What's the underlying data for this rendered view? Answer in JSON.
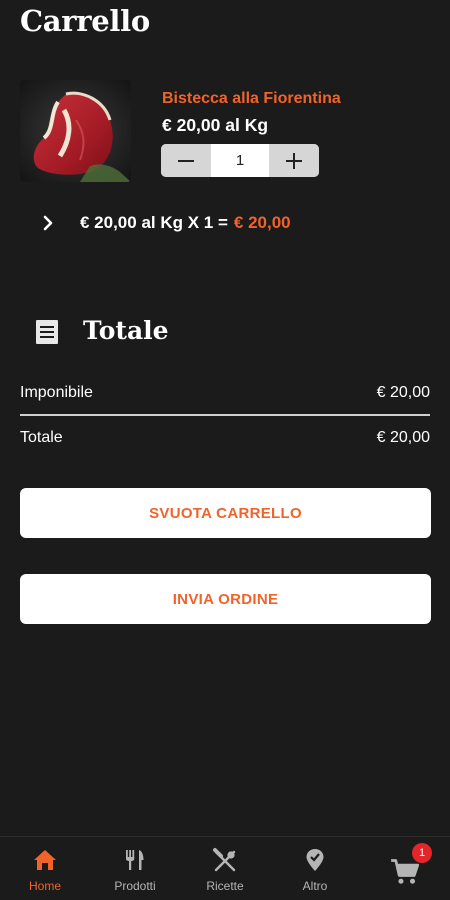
{
  "header": {
    "title": "Carrello"
  },
  "cart_items": [
    {
      "name": "Bistecca alla Fiorentina",
      "unit_price": "€ 20,00 al Kg",
      "quantity": "1",
      "line_calc": "€ 20,00 al Kg X 1 =",
      "line_total": "€ 20,00"
    }
  ],
  "summary": {
    "title": "Totale",
    "rows": [
      {
        "label": "Imponibile",
        "value": "€ 20,00"
      },
      {
        "label": "Totale",
        "value": "€ 20,00"
      }
    ]
  },
  "actions": {
    "empty_cart": "SVUOTA CARRELLO",
    "send_order": "INVIA ORDINE"
  },
  "nav": {
    "items": [
      {
        "label": "Home",
        "icon": "home-icon",
        "active": true
      },
      {
        "label": "Prodotti",
        "icon": "fork-knife-icon",
        "active": false
      },
      {
        "label": "Ricette",
        "icon": "crossed-utensils-icon",
        "active": false
      },
      {
        "label": "Altro",
        "icon": "map-pin-icon",
        "active": false
      },
      {
        "label": "",
        "icon": "cart-icon",
        "active": false
      }
    ],
    "cart_count": "1"
  },
  "colors": {
    "background": "#1b1b1c",
    "accent": "#f0632a",
    "badge": "#e4252a"
  }
}
